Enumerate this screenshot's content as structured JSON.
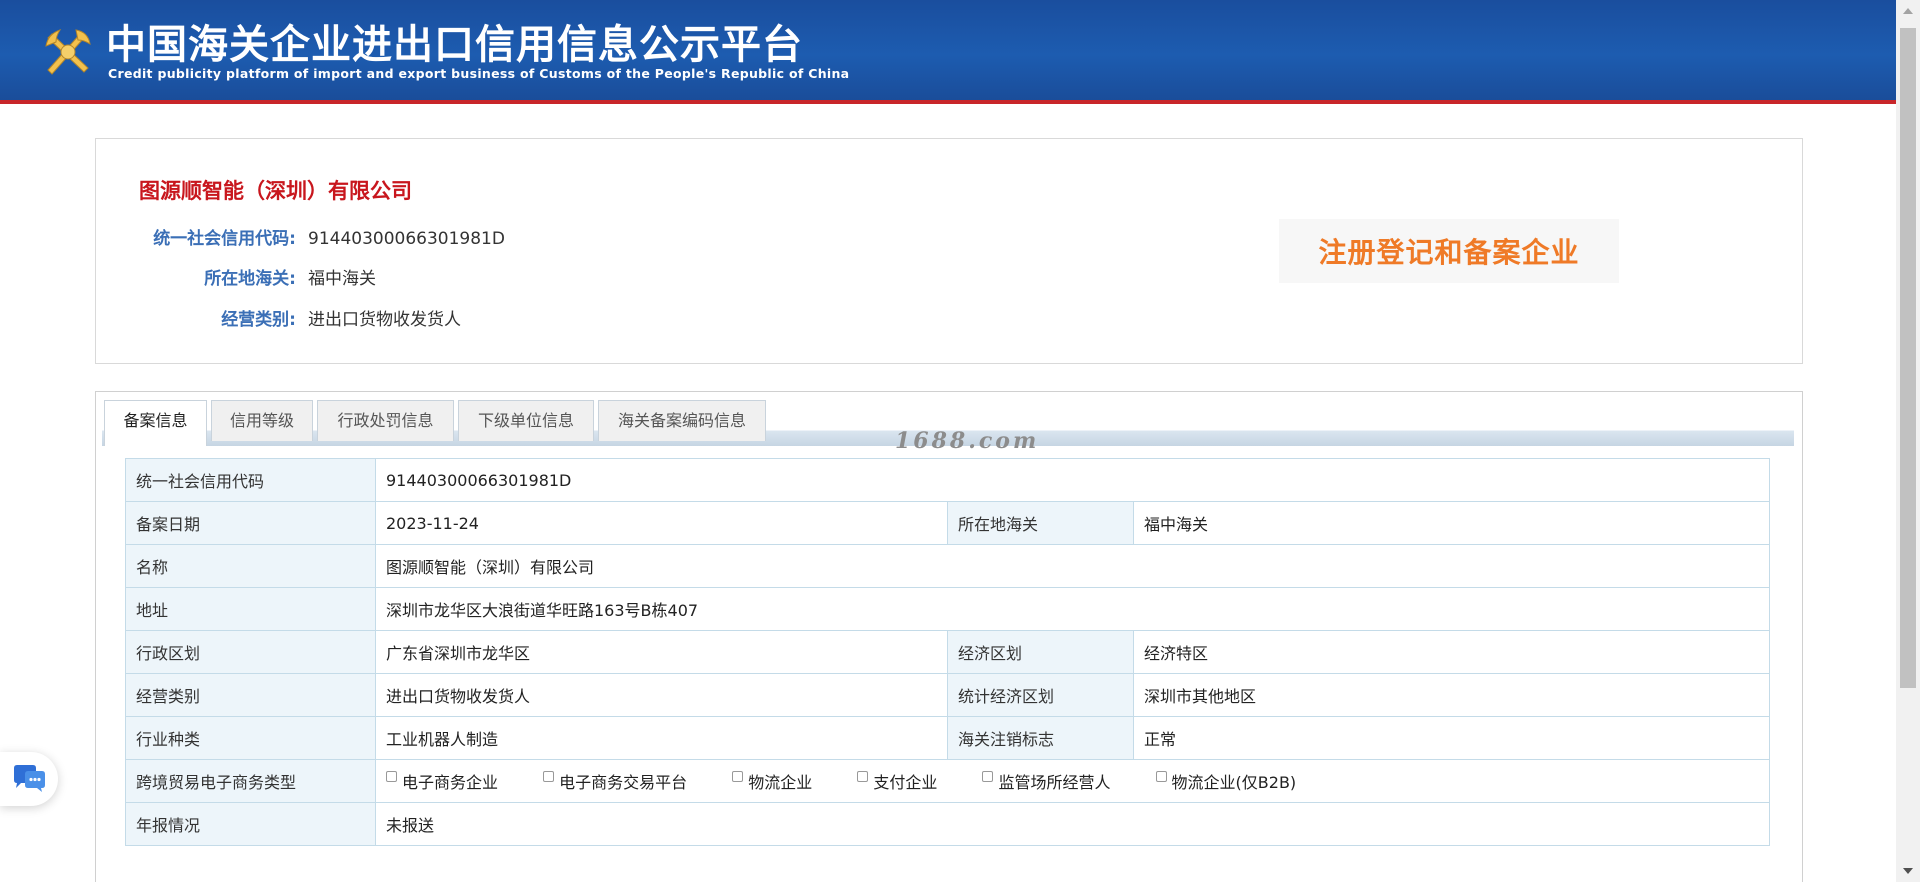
{
  "header": {
    "title": "中国海关企业进出口信用信息公示平台",
    "subtitle": "Credit publicity platform of import and export business of Customs of the People's Republic of China"
  },
  "company": {
    "name": "图源顺智能（深圳）有限公司",
    "fields": [
      {
        "label": "统一社会信用代码:",
        "value": "91440300066301981D"
      },
      {
        "label": "所在地海关:",
        "value": "福中海关"
      },
      {
        "label": "经营类别:",
        "value": "进出口货物收发货人"
      }
    ],
    "badge": "注册登记和备案企业"
  },
  "tabs": [
    {
      "label": "备案信息",
      "active": true
    },
    {
      "label": "信用等级",
      "active": false
    },
    {
      "label": "行政处罚信息",
      "active": false
    },
    {
      "label": "下级单位信息",
      "active": false
    },
    {
      "label": "海关备案编码信息",
      "active": false
    }
  ],
  "watermark": "1688.com",
  "details": {
    "row1": {
      "k": "统一社会信用代码",
      "v": "91440300066301981D"
    },
    "row2": {
      "k": "备案日期",
      "v": "2023-11-24",
      "k2": "所在地海关",
      "v2": "福中海关"
    },
    "row3": {
      "k": "名称",
      "v": "图源顺智能（深圳）有限公司"
    },
    "row4": {
      "k": "地址",
      "v": "深圳市龙华区大浪街道华旺路163号B栋407"
    },
    "row5": {
      "k": "行政区划",
      "v": "广东省深圳市龙华区",
      "k2": "经济区划",
      "v2": "经济特区"
    },
    "row6": {
      "k": "经营类别",
      "v": "进出口货物收发货人",
      "k2": "统计经济区划",
      "v2": "深圳市其他地区"
    },
    "row7": {
      "k": "行业种类",
      "v": "工业机器人制造",
      "k2": "海关注销标志",
      "v2": "正常"
    },
    "row8": {
      "k": "跨境贸易电子商务类型",
      "options": [
        "电子商务企业",
        "电子商务交易平台",
        "物流企业",
        "支付企业",
        "监管场所经营人",
        "物流企业(仅B2B)"
      ]
    },
    "row9": {
      "k": "年报情况",
      "v": "未报送"
    }
  },
  "colors": {
    "header_blue": "#1d5cb0",
    "header_red_line": "#c8262a",
    "company_red": "#c8161d",
    "label_blue": "#3b6fb6",
    "badge_orange": "#ef7a27",
    "table_key_bg": "#edf5fa"
  }
}
